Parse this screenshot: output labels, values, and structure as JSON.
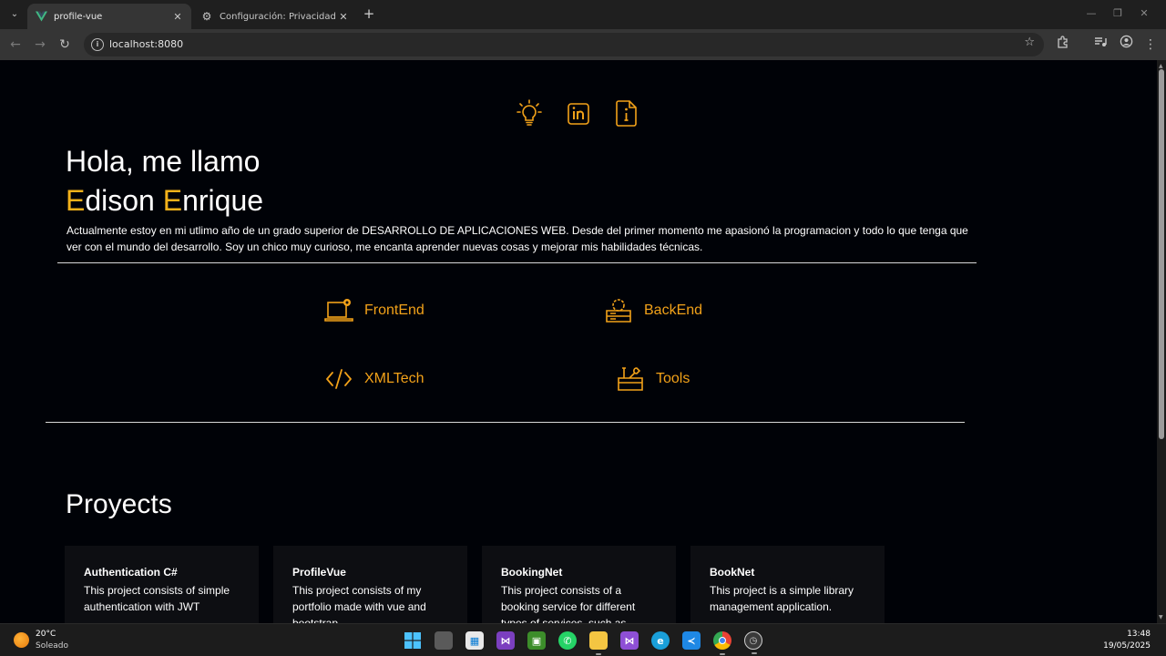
{
  "browser": {
    "tabs": [
      {
        "title": "profile-vue",
        "favicon": "vue-logo-icon",
        "active": true
      },
      {
        "title": "Configuración: Privacidad y seguridad",
        "favicon": "settings-gear-icon",
        "active": false
      }
    ],
    "new_tab_icon": "plus-icon",
    "window_controls": [
      "minimize-icon",
      "restore-icon",
      "close-icon"
    ],
    "nav_icons": [
      "back-arrow-icon",
      "forward-arrow-icon",
      "reload-icon"
    ],
    "address": "localhost:8080",
    "toolbar_icons": [
      "bookmark-star-icon",
      "extensions-icon",
      "media-icon",
      "profile-icon",
      "menu-icon"
    ]
  },
  "page": {
    "social_icons": [
      "lightbulb-icon",
      "linkedin-icon",
      "info-document-icon"
    ],
    "greeting": "Hola, me llamo",
    "name": {
      "first_initial": "E",
      "first_rest": "dison ",
      "last_initial": "E",
      "last_rest": "nrique"
    },
    "bio": "Actualmente estoy en mi utlimo año de un grado superior de DESARROLLO DE APLICACIONES WEB. Desde del primer momento me apasionó la programacion y todo lo que tenga que ver con el mundo del desarrollo. Soy un chico muy curioso, me encanta aprender nuevas cosas y mejorar mis habilidades técnicas.",
    "skills": [
      {
        "label": "FrontEnd",
        "icon": "laptop-gear-icon"
      },
      {
        "label": "BackEnd",
        "icon": "server-gear-icon"
      },
      {
        "label": "XMLTech",
        "icon": "code-brackets-icon"
      },
      {
        "label": "Tools",
        "icon": "toolbox-icon"
      }
    ],
    "projects_title": "Proyects",
    "projects": [
      {
        "title": "Authentication C#",
        "description": "This project consists of simple authentication with JWT"
      },
      {
        "title": "ProfileVue",
        "description": "This project consists of my portfolio made with vue and bootstrap"
      },
      {
        "title": "BookingNet",
        "description": "This project consists of a booking service for different types of services, such as"
      },
      {
        "title": "BookNet",
        "description": "This project is a simple library management application."
      }
    ],
    "accent_color": "#f2b11a",
    "icon_color": "#f2a219",
    "background_color": "#000207"
  },
  "taskbar": {
    "weather": {
      "temp": "20°C",
      "desc": "Soleado"
    },
    "apps": [
      "windows-start-icon",
      "file-manager-icon",
      "store-icon",
      "visual-studio-icon",
      "minecraft-icon",
      "whatsapp-icon",
      "file-explorer-icon",
      "visual-studio-icon",
      "edge-icon",
      "vscode-icon",
      "chrome-icon",
      "clock-app-icon"
    ],
    "time": "13:48",
    "date": "19/05/2025"
  }
}
